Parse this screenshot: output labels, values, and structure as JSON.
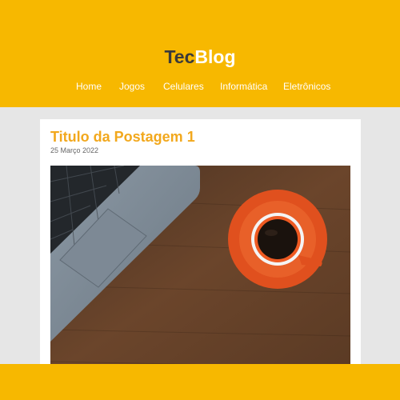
{
  "header": {
    "logo_part1": "Tec",
    "logo_part2": "Blog",
    "background_color": "#f7b800",
    "nav": [
      {
        "label": "Home"
      },
      {
        "label": "Jogos"
      },
      {
        "label": "Celulares"
      },
      {
        "label": "Informática"
      },
      {
        "label": "Eletrônicos"
      }
    ]
  },
  "post": {
    "title": "Titulo da Postagem 1",
    "date": "25 Março 2022",
    "image": {
      "subject": "laptop-and-coffee-cup-on-wooden-desk"
    }
  },
  "colors": {
    "accent": "#f7b800",
    "title": "#f2a81d",
    "background": "#e6e6e6"
  }
}
